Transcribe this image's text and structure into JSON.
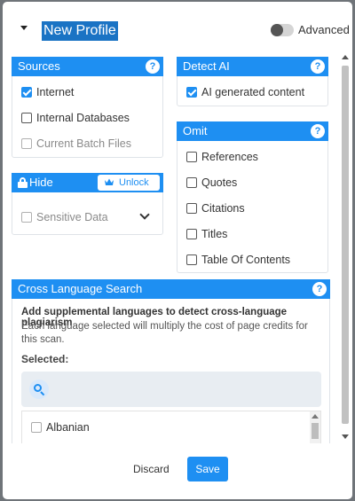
{
  "header": {
    "title": "New Profile",
    "advanced_label": "Advanced"
  },
  "sources": {
    "title": "Sources",
    "items": [
      {
        "label": "Internet",
        "checked": true,
        "disabled": false
      },
      {
        "label": "Internal Databases",
        "checked": false,
        "disabled": false
      },
      {
        "label": "Current Batch Files",
        "checked": false,
        "disabled": true
      }
    ]
  },
  "detect_ai": {
    "title": "Detect AI",
    "items": [
      {
        "label": "AI generated content",
        "checked": true
      }
    ]
  },
  "hide": {
    "title": "Hide",
    "unlock_label": "Unlock",
    "items": [
      {
        "label": "Sensitive Data",
        "checked": false,
        "disabled": true
      }
    ]
  },
  "omit": {
    "title": "Omit",
    "items": [
      {
        "label": "References",
        "checked": false
      },
      {
        "label": "Quotes",
        "checked": false
      },
      {
        "label": "Citations",
        "checked": false
      },
      {
        "label": "Titles",
        "checked": false
      },
      {
        "label": "Table Of Contents",
        "checked": false
      }
    ]
  },
  "cross_language": {
    "title": "Cross Language Search",
    "heading": "Add supplemental languages to detect cross-language plagiarism",
    "description": "Each language selected will multiply the cost of page credits for this scan.",
    "selected_label": "Selected:",
    "languages": [
      {
        "label": "Albanian",
        "checked": false
      }
    ]
  },
  "help_glyph": "?",
  "footer": {
    "discard_label": "Discard",
    "save_label": "Save"
  },
  "colors": {
    "accent": "#1e8ff2",
    "title_highlight": "#1a73c4"
  }
}
